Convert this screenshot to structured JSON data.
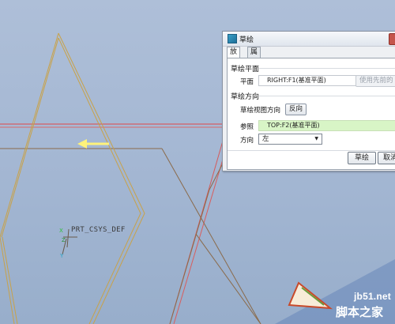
{
  "viewport": {
    "csys_label": "PRT_CSYS_DEF",
    "colors": {
      "background": "#a4b7d3",
      "datum_plane_edge": "#e04040",
      "sketch_edge": "#c8a24a",
      "direction_arrow": "#fff27a"
    }
  },
  "dialog": {
    "title": "草绘",
    "tabs": [
      {
        "label": "放置",
        "active": true
      },
      {
        "label": "属性",
        "active": false
      }
    ],
    "sketch_plane": {
      "heading": "草绘平面",
      "plane_label": "平面",
      "plane_value": "RIGHT:F1(基准平面)",
      "use_previous_label": "使用先前的"
    },
    "sketch_orientation": {
      "heading": "草绘方向",
      "view_direction_label": "草绘视图方向",
      "flip_label": "反向",
      "reference_label": "参照",
      "reference_value": "TOP:F2(基准平面)",
      "orientation_label": "方向",
      "orientation_value": "左"
    },
    "footer": {
      "sketch_button": "草绘",
      "cancel_button": "取消"
    }
  },
  "watermark": {
    "site": "jb51.net",
    "name": "脚本之家"
  }
}
